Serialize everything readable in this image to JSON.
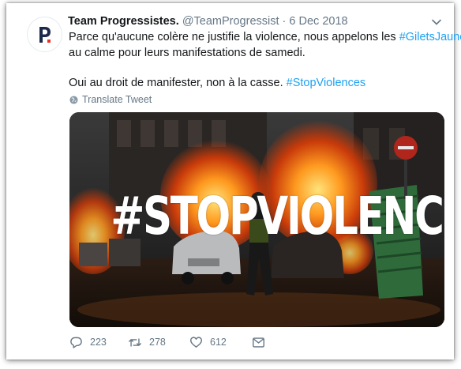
{
  "tweet": {
    "author_name": "Team Progressistes.",
    "handle": "@TeamProgressist",
    "separator": "·",
    "date": "6 Dec 2018",
    "avatar_letter": "P",
    "line1_text": "Parce qu'aucune colère ne justifie la violence, nous appelons les ",
    "line1_hashtag": "#GiletsJaunes",
    "line2_text": "au calme pour leurs manifestations de samedi.",
    "line3_text": "Oui au droit de manifester, non à la casse. ",
    "line3_hashtag": "#StopViolences",
    "translate_label": "Translate Tweet",
    "image_overlay_text": "#STOPVIOLENCES",
    "stats": {
      "replies": "223",
      "retweets": "278",
      "likes": "612"
    }
  },
  "colors": {
    "hashtag": "#1da1f2",
    "muted": "#657786",
    "text": "#14171a"
  },
  "icons": [
    "p-logo-icon",
    "chevron-down-icon",
    "globe-icon",
    "reply-icon",
    "retweet-icon",
    "like-icon",
    "share-icon"
  ]
}
